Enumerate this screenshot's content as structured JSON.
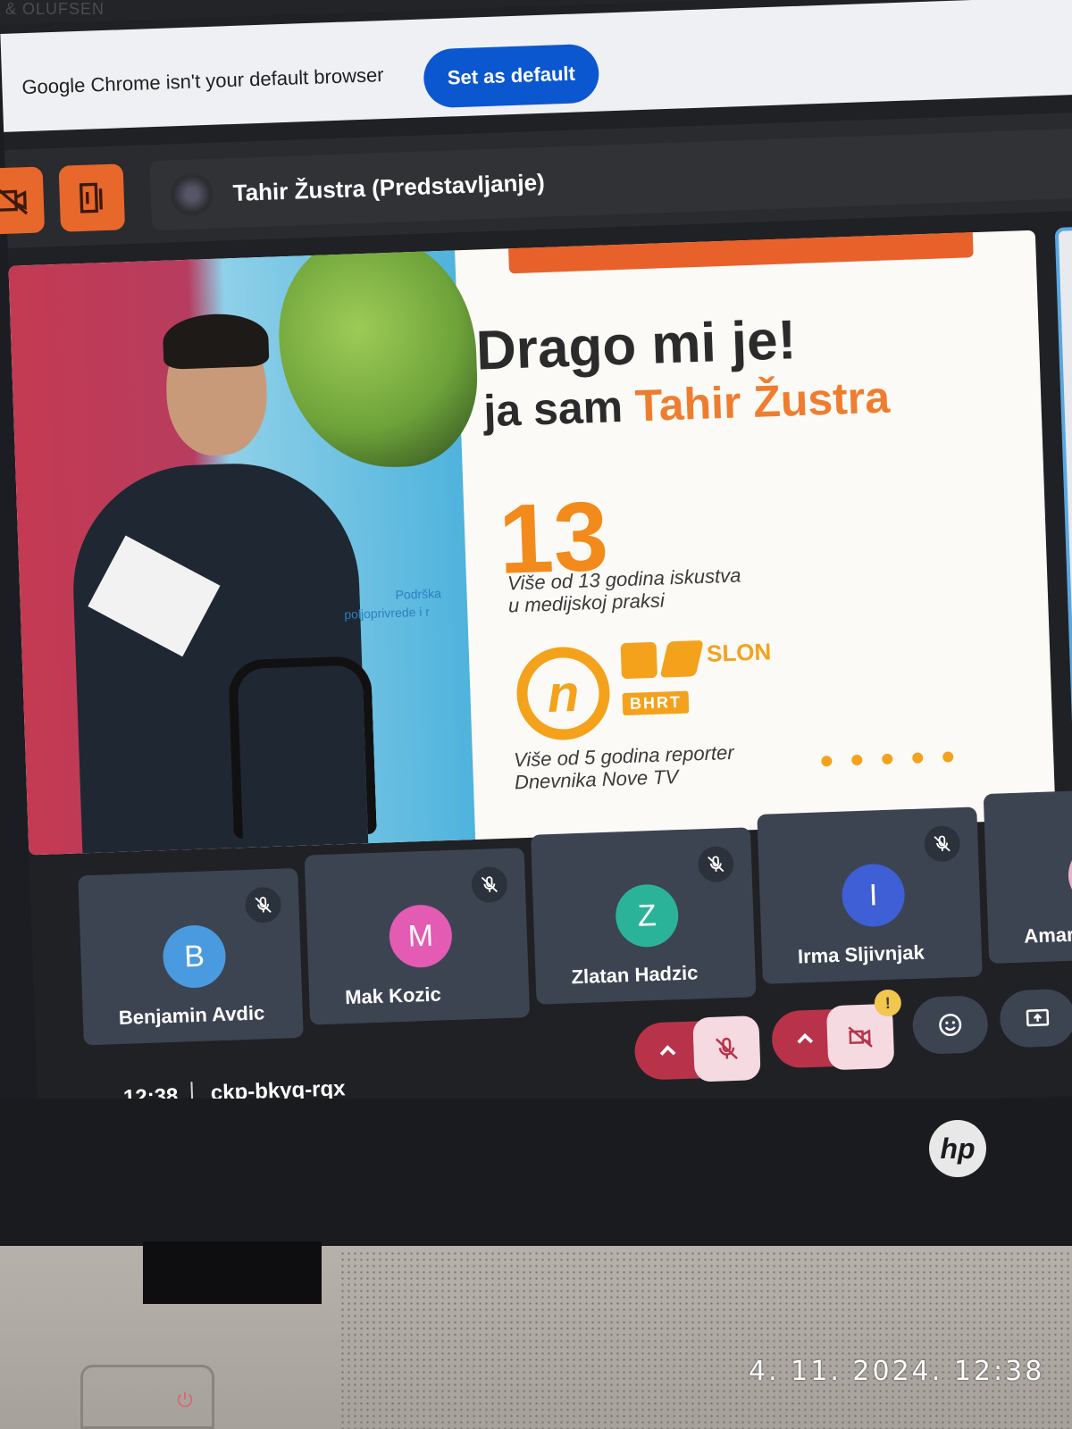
{
  "bezel": {
    "brand": "& OLUFSEN"
  },
  "infobar": {
    "message": "Google Chrome isn't your default browser",
    "set_default_label": "Set as default"
  },
  "meet": {
    "presenter": "Tahir Žustra (Predstavljanje)",
    "slide": {
      "photo_caption_1": "Podrška",
      "photo_caption_2": "poljoprivrede i r",
      "title_line1": "Drago mi je!",
      "title_line2_prefix": "ja sam ",
      "title_line2_name": "Tahir Žustra",
      "big_number": "13",
      "experience_line1": "Više od 13 godina iskustva",
      "experience_line2": "u medijskoj praksi",
      "logo_n": "n",
      "logo_slon": "SLON",
      "logo_bhrt": "BHRT",
      "reporter_line1": "Više od 5 godina reporter",
      "reporter_line2": "Dnevnika Nove TV",
      "dot_count": 5
    },
    "participants": [
      {
        "initial": "B",
        "name": "Benjamin Avdic",
        "color": "#4a9ae0"
      },
      {
        "initial": "M",
        "name": "Mak Kozic",
        "color": "#e35bb2"
      },
      {
        "initial": "Z",
        "name": "Zlatan Hadzic",
        "color": "#2bb39a"
      },
      {
        "initial": "I",
        "name": "Irma Sljivnjak",
        "color": "#3f5fd6"
      },
      {
        "initial": "A",
        "name": "Amar Ma",
        "color": "#e8b4c8"
      }
    ],
    "time": "12:38",
    "meeting_code": "ckp-bkyq-rqx",
    "camera_warning": "!",
    "icons": {
      "mic": "mic-off-icon",
      "camera": "video-off-icon",
      "emoji": "emoji-icon",
      "present": "present-screen-icon",
      "expand": "chevron-up-icon",
      "leave": "leave-door-icon"
    }
  },
  "laptop": {
    "logo": "hp"
  },
  "photo_timestamp": "4. 11. 2024.  12:38"
}
